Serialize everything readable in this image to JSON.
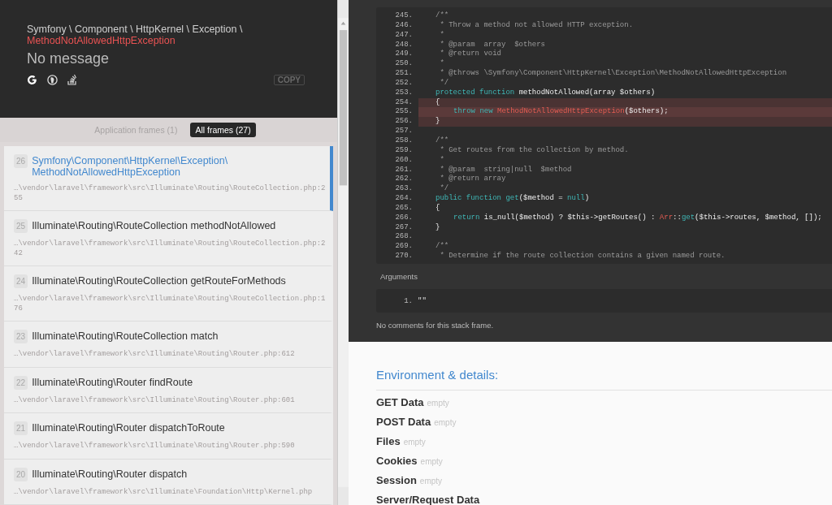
{
  "exception": {
    "namespace": "Symfony \\ Component \\ HttpKernel \\ Exception \\",
    "class": "MethodNotAllowedHttpException",
    "message": "No message",
    "copy_button": "COPY"
  },
  "frame_filters": [
    {
      "label": "Application frames (1)",
      "selected": false
    },
    {
      "label": "All frames (27)",
      "selected": true
    }
  ],
  "frames": [
    {
      "number": "26",
      "title": "Symfony\\Component\\HttpKernel\\Exception\\MethodNotAllowedHttpException",
      "path": "…\\vendor\\laravel\\framework\\src\\Illuminate\\Routing\\RouteCollection.php:255",
      "selected": true
    },
    {
      "number": "25",
      "title": "Illuminate\\Routing\\RouteCollection methodNotAllowed",
      "path": "…\\vendor\\laravel\\framework\\src\\Illuminate\\Routing\\RouteCollection.php:242",
      "selected": false
    },
    {
      "number": "24",
      "title": "Illuminate\\Routing\\RouteCollection getRouteForMethods",
      "path": "…\\vendor\\laravel\\framework\\src\\Illuminate\\Routing\\RouteCollection.php:176",
      "selected": false
    },
    {
      "number": "23",
      "title": "Illuminate\\Routing\\RouteCollection match",
      "path": "…\\vendor\\laravel\\framework\\src\\Illuminate\\Routing\\Router.php:612",
      "selected": false
    },
    {
      "number": "22",
      "title": "Illuminate\\Routing\\Router findRoute",
      "path": "…\\vendor\\laravel\\framework\\src\\Illuminate\\Routing\\Router.php:601",
      "selected": false
    },
    {
      "number": "21",
      "title": "Illuminate\\Routing\\Router dispatchToRoute",
      "path": "…\\vendor\\laravel\\framework\\src\\Illuminate\\Routing\\Router.php:590",
      "selected": false
    },
    {
      "number": "20",
      "title": "Illuminate\\Routing\\Router dispatch",
      "path": "…\\vendor\\laravel\\framework\\src\\Illuminate\\Foundation\\Http\\Kernel.php",
      "selected": false
    }
  ],
  "code": {
    "lines": [
      {
        "number": "245.",
        "highlighted": false,
        "error": false,
        "tokens": [
          {
            "kind": "comment",
            "text": "/**"
          }
        ]
      },
      {
        "number": "246.",
        "highlighted": false,
        "error": false,
        "tokens": [
          {
            "kind": "comment",
            "text": " * Throw a method not allowed HTTP exception."
          }
        ]
      },
      {
        "number": "247.",
        "highlighted": false,
        "error": false,
        "tokens": [
          {
            "kind": "comment",
            "text": " *"
          }
        ]
      },
      {
        "number": "248.",
        "highlighted": false,
        "error": false,
        "tokens": [
          {
            "kind": "comment",
            "text": " * @param  array  $others"
          }
        ]
      },
      {
        "number": "249.",
        "highlighted": false,
        "error": false,
        "tokens": [
          {
            "kind": "comment",
            "text": " * @return void"
          }
        ]
      },
      {
        "number": "250.",
        "highlighted": false,
        "error": false,
        "tokens": [
          {
            "kind": "comment",
            "text": " *"
          }
        ]
      },
      {
        "number": "251.",
        "highlighted": false,
        "error": false,
        "tokens": [
          {
            "kind": "comment",
            "text": " * @throws \\Symfony\\Component\\HttpKernel\\Exception\\MethodNotAllowedHttpException"
          }
        ]
      },
      {
        "number": "252.",
        "highlighted": false,
        "error": false,
        "tokens": [
          {
            "kind": "comment",
            "text": " */"
          }
        ]
      },
      {
        "number": "253.",
        "highlighted": false,
        "error": false,
        "tokens": [
          {
            "kind": "keyword",
            "text": "protected function "
          },
          {
            "kind": "plain",
            "text": "methodNotAllowed(array $others)"
          }
        ]
      },
      {
        "number": "254.",
        "highlighted": true,
        "error": false,
        "tokens": [
          {
            "kind": "plain",
            "text": "{"
          }
        ]
      },
      {
        "number": "255.",
        "highlighted": true,
        "error": true,
        "indented": true,
        "tokens": [
          {
            "kind": "keyword",
            "text": "throw new "
          },
          {
            "kind": "name",
            "text": "MethodNotAllowedHttpException"
          },
          {
            "kind": "plain",
            "text": "($others);"
          }
        ]
      },
      {
        "number": "256.",
        "highlighted": true,
        "error": false,
        "tokens": [
          {
            "kind": "plain",
            "text": "}"
          }
        ]
      },
      {
        "number": "257.",
        "highlighted": false,
        "error": false
      },
      {
        "number": "258.",
        "highlighted": false,
        "error": false,
        "tokens": [
          {
            "kind": "comment",
            "text": "/**"
          }
        ]
      },
      {
        "number": "259.",
        "highlighted": false,
        "error": false,
        "tokens": [
          {
            "kind": "comment",
            "text": " * Get routes from the collection by method."
          }
        ]
      },
      {
        "number": "260.",
        "highlighted": false,
        "error": false,
        "tokens": [
          {
            "kind": "comment",
            "text": " *"
          }
        ]
      },
      {
        "number": "261.",
        "highlighted": false,
        "error": false,
        "tokens": [
          {
            "kind": "comment",
            "text": " * @param  string|null  $method"
          }
        ]
      },
      {
        "number": "262.",
        "highlighted": false,
        "error": false,
        "tokens": [
          {
            "kind": "comment",
            "text": " * @return array"
          }
        ]
      },
      {
        "number": "263.",
        "highlighted": false,
        "error": false,
        "tokens": [
          {
            "kind": "comment",
            "text": " */"
          }
        ]
      },
      {
        "number": "264.",
        "highlighted": false,
        "error": false,
        "tokens": [
          {
            "kind": "keyword",
            "text": "public function get"
          },
          {
            "kind": "plain",
            "text": "($method = "
          },
          {
            "kind": "keyword",
            "text": "null"
          },
          {
            "kind": "plain",
            "text": ")"
          }
        ]
      },
      {
        "number": "265.",
        "highlighted": false,
        "error": false,
        "tokens": [
          {
            "kind": "plain",
            "text": "{"
          }
        ]
      },
      {
        "number": "266.",
        "highlighted": false,
        "error": false,
        "indented": true,
        "tokens": [
          {
            "kind": "keyword",
            "text": "return "
          },
          {
            "kind": "plain",
            "text": "is_null($method) ? $this->getRoutes() : "
          },
          {
            "kind": "name",
            "text": "Arr"
          },
          {
            "kind": "plain",
            "text": "::"
          },
          {
            "kind": "keyword",
            "text": "get"
          },
          {
            "kind": "plain",
            "text": "($this->routes, $method, []);"
          }
        ]
      },
      {
        "number": "267.",
        "highlighted": false,
        "error": false,
        "tokens": [
          {
            "kind": "plain",
            "text": "}"
          }
        ]
      },
      {
        "number": "268.",
        "highlighted": false,
        "error": false
      },
      {
        "number": "269.",
        "highlighted": false,
        "error": false,
        "tokens": [
          {
            "kind": "comment",
            "text": "/**"
          }
        ]
      },
      {
        "number": "270.",
        "highlighted": false,
        "error": false,
        "tokens": [
          {
            "kind": "comment",
            "text": " * Determine if the route collection contains a given named route."
          }
        ]
      }
    ]
  },
  "arguments": {
    "title": "Arguments",
    "items": [
      {
        "number": "1.",
        "value": "\"\""
      }
    ]
  },
  "comments": "No comments for this stack frame.",
  "environment": {
    "title": "Environment & details:",
    "sections": [
      {
        "label": "GET Data",
        "value": "empty"
      },
      {
        "label": "POST Data",
        "value": "empty"
      },
      {
        "label": "Files",
        "value": "empty"
      },
      {
        "label": "Cookies",
        "value": "empty"
      },
      {
        "label": "Session",
        "value": "empty"
      },
      {
        "label": "Server/Request Data"
      }
    ]
  }
}
